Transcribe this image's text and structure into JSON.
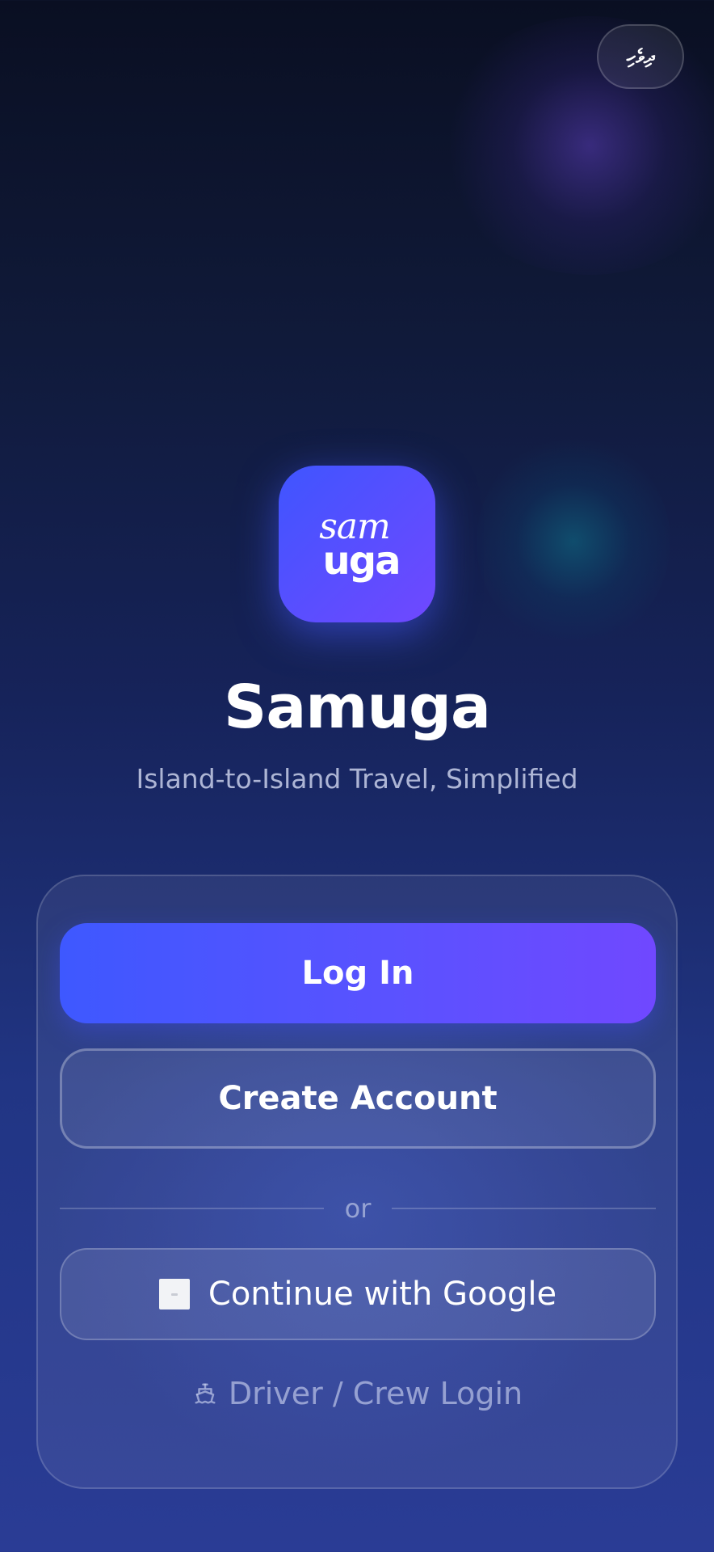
{
  "language_toggle": {
    "label": "ދިވެހި"
  },
  "logo": {
    "line1": "sam",
    "line2": "uga"
  },
  "app": {
    "title": "Samuga",
    "tagline": "Island-to-Island Travel, Simplified"
  },
  "auth": {
    "login_label": "Log In",
    "create_account_label": "Create Account",
    "divider_text": "or",
    "google_label": "Continue with Google",
    "google_icon": "google-icon",
    "driver_label": "Driver / Crew Login",
    "driver_icon": "ship-icon"
  },
  "colors": {
    "accent_start": "#3e58ff",
    "accent_end": "#7048ff",
    "background_top": "#0a0f22",
    "background_bottom": "#2a3c95"
  }
}
